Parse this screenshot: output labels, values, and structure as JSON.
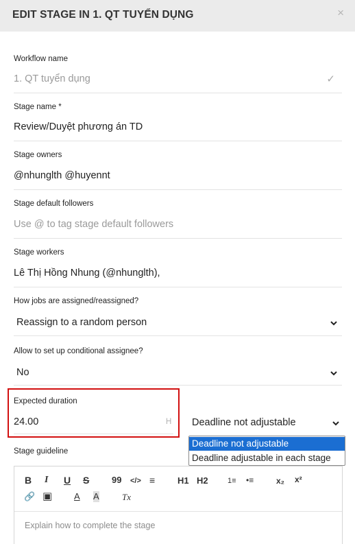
{
  "modal": {
    "title": "EDIT STAGE IN 1. QT TUYỂN DỤNG",
    "close": "×"
  },
  "workflow": {
    "label": "Workflow name",
    "value": "1. QT tuyển dụng",
    "check": "✓"
  },
  "stage_name": {
    "label": "Stage name *",
    "value": "Review/Duyệt phương án TD"
  },
  "owners": {
    "label": "Stage owners",
    "value": "@nhunglth @huyennt"
  },
  "followers": {
    "label": "Stage default followers",
    "placeholder": "Use @ to tag stage default followers"
  },
  "workers": {
    "label": "Stage workers",
    "value": "Lê Thị Hồng Nhung (@nhunglth),"
  },
  "assign": {
    "label": "How jobs are assigned/reassigned?",
    "value": "Reassign to a random person"
  },
  "conditional": {
    "label": "Allow to set up conditional assignee?",
    "value": "No"
  },
  "duration": {
    "label": "Expected duration",
    "value": "24.00",
    "unit": "H"
  },
  "deadline": {
    "value": "Deadline not adjustable",
    "options": [
      "Deadline not adjustable",
      "Deadline adjustable in each stage"
    ]
  },
  "guideline": {
    "label": "Stage guideline",
    "placeholder": "Explain how to complete the stage",
    "toolbar": {
      "bold": "B",
      "italic": "I",
      "underline": "U",
      "strike": "S",
      "quote": "99",
      "code": "</>",
      "align": "≡",
      "h1": "H1",
      "h2": "H2",
      "ol": "1≡",
      "ul": "•≡",
      "sub": "x₂",
      "sup": "x²",
      "link": "🔗",
      "image": "▣",
      "text_color": "A",
      "bg_color": "A",
      "clear": "Tx"
    }
  },
  "colors": {
    "highlight_border": "#d20f0f",
    "selected_option": "#1b6ed2"
  }
}
